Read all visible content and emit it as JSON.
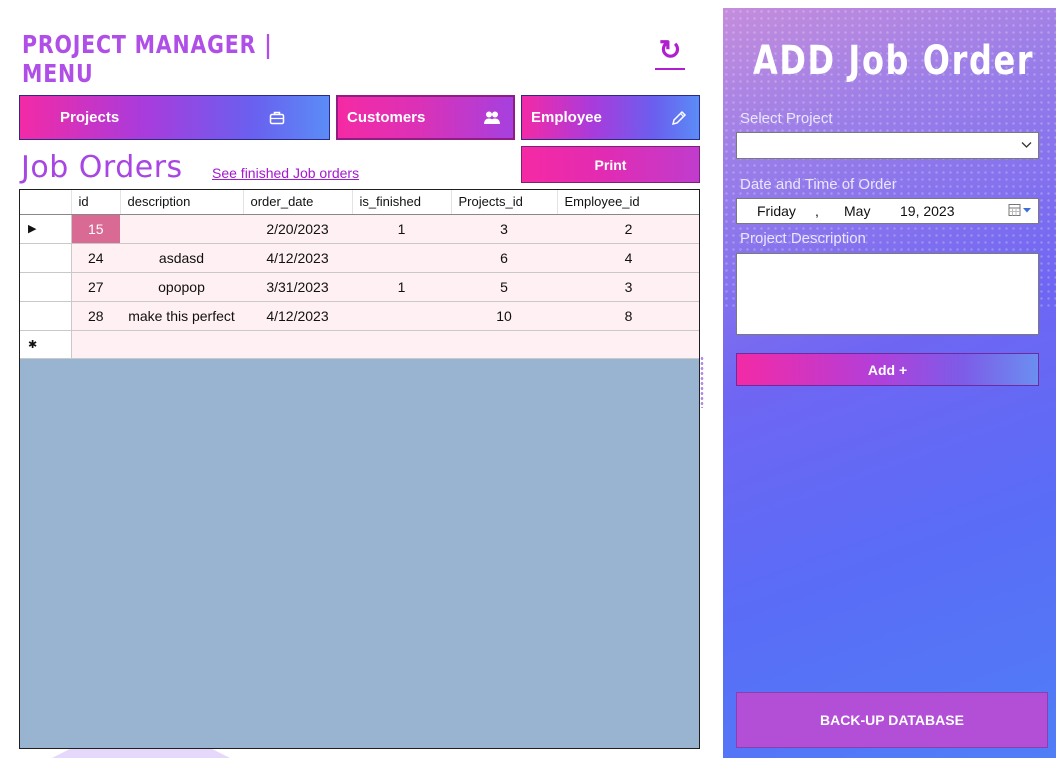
{
  "header": {
    "title_line1": "PROJECT MANAGER  |",
    "title_line2": "MENU",
    "refresh_icon": "refresh-icon",
    "refresh_glyph": "↻"
  },
  "nav": {
    "projects_label": "Projects",
    "customers_label": "Customers",
    "employee_label": "Employee",
    "projects_icon": "briefcase-icon",
    "customers_icon": "people-icon",
    "employee_icon": "pencil-icon"
  },
  "main": {
    "title": "Job Orders",
    "finished_link": "See finished Job orders",
    "print_label": "Print"
  },
  "grid": {
    "columns": [
      "id",
      "description",
      "order_date",
      "is_finished",
      "Projects_id",
      "Employee_id"
    ],
    "rows": [
      [
        "15",
        "",
        "2/20/2023",
        "1",
        "3",
        "2"
      ],
      [
        "24",
        "asdasd",
        "4/12/2023",
        "",
        "6",
        "4"
      ],
      [
        "27",
        "opopop",
        "3/31/2023",
        "1",
        "5",
        "3"
      ],
      [
        "28",
        "make this perfect",
        "4/12/2023",
        "",
        "10",
        "8"
      ]
    ],
    "current_row_marker": "▶",
    "new_row_marker": "✱"
  },
  "panel": {
    "title": "ADD Job Order",
    "select_project_label": "Select Project",
    "select_project_value": "",
    "date_label": "Date and Time of Order",
    "date_weekday": "Friday",
    "date_sep": ",",
    "date_month": "May",
    "date_day_year": "19, 2023",
    "description_label": "Project Description",
    "description_value": "",
    "add_label": "Add +",
    "backup_label": "BACK-UP DATABASE"
  },
  "colors": {
    "accent_purple": "#a746e3",
    "accent_pink": "#f32aa6",
    "grid_background": "#99b4d1",
    "row_background": "#fff0f3",
    "selected_cell": "#d96a93",
    "panel_blue": "#5a6cf6",
    "backup_button": "#b24fd6"
  }
}
